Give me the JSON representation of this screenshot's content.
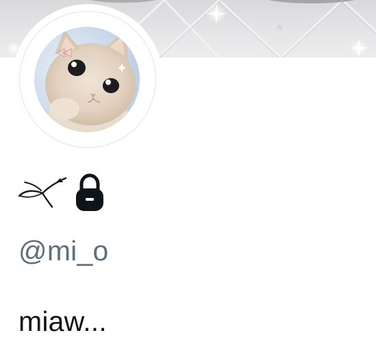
{
  "profile": {
    "display_name_icons": [
      "bird-glyph-icon",
      "lock-icon"
    ],
    "handle": "@mi_o",
    "bio": "miaw..."
  },
  "colors": {
    "handle_text": "#5e6e7a",
    "bio_text": "#0f1419",
    "lock_fill": "#0f1419",
    "banner_base": "#e5e5e7"
  }
}
